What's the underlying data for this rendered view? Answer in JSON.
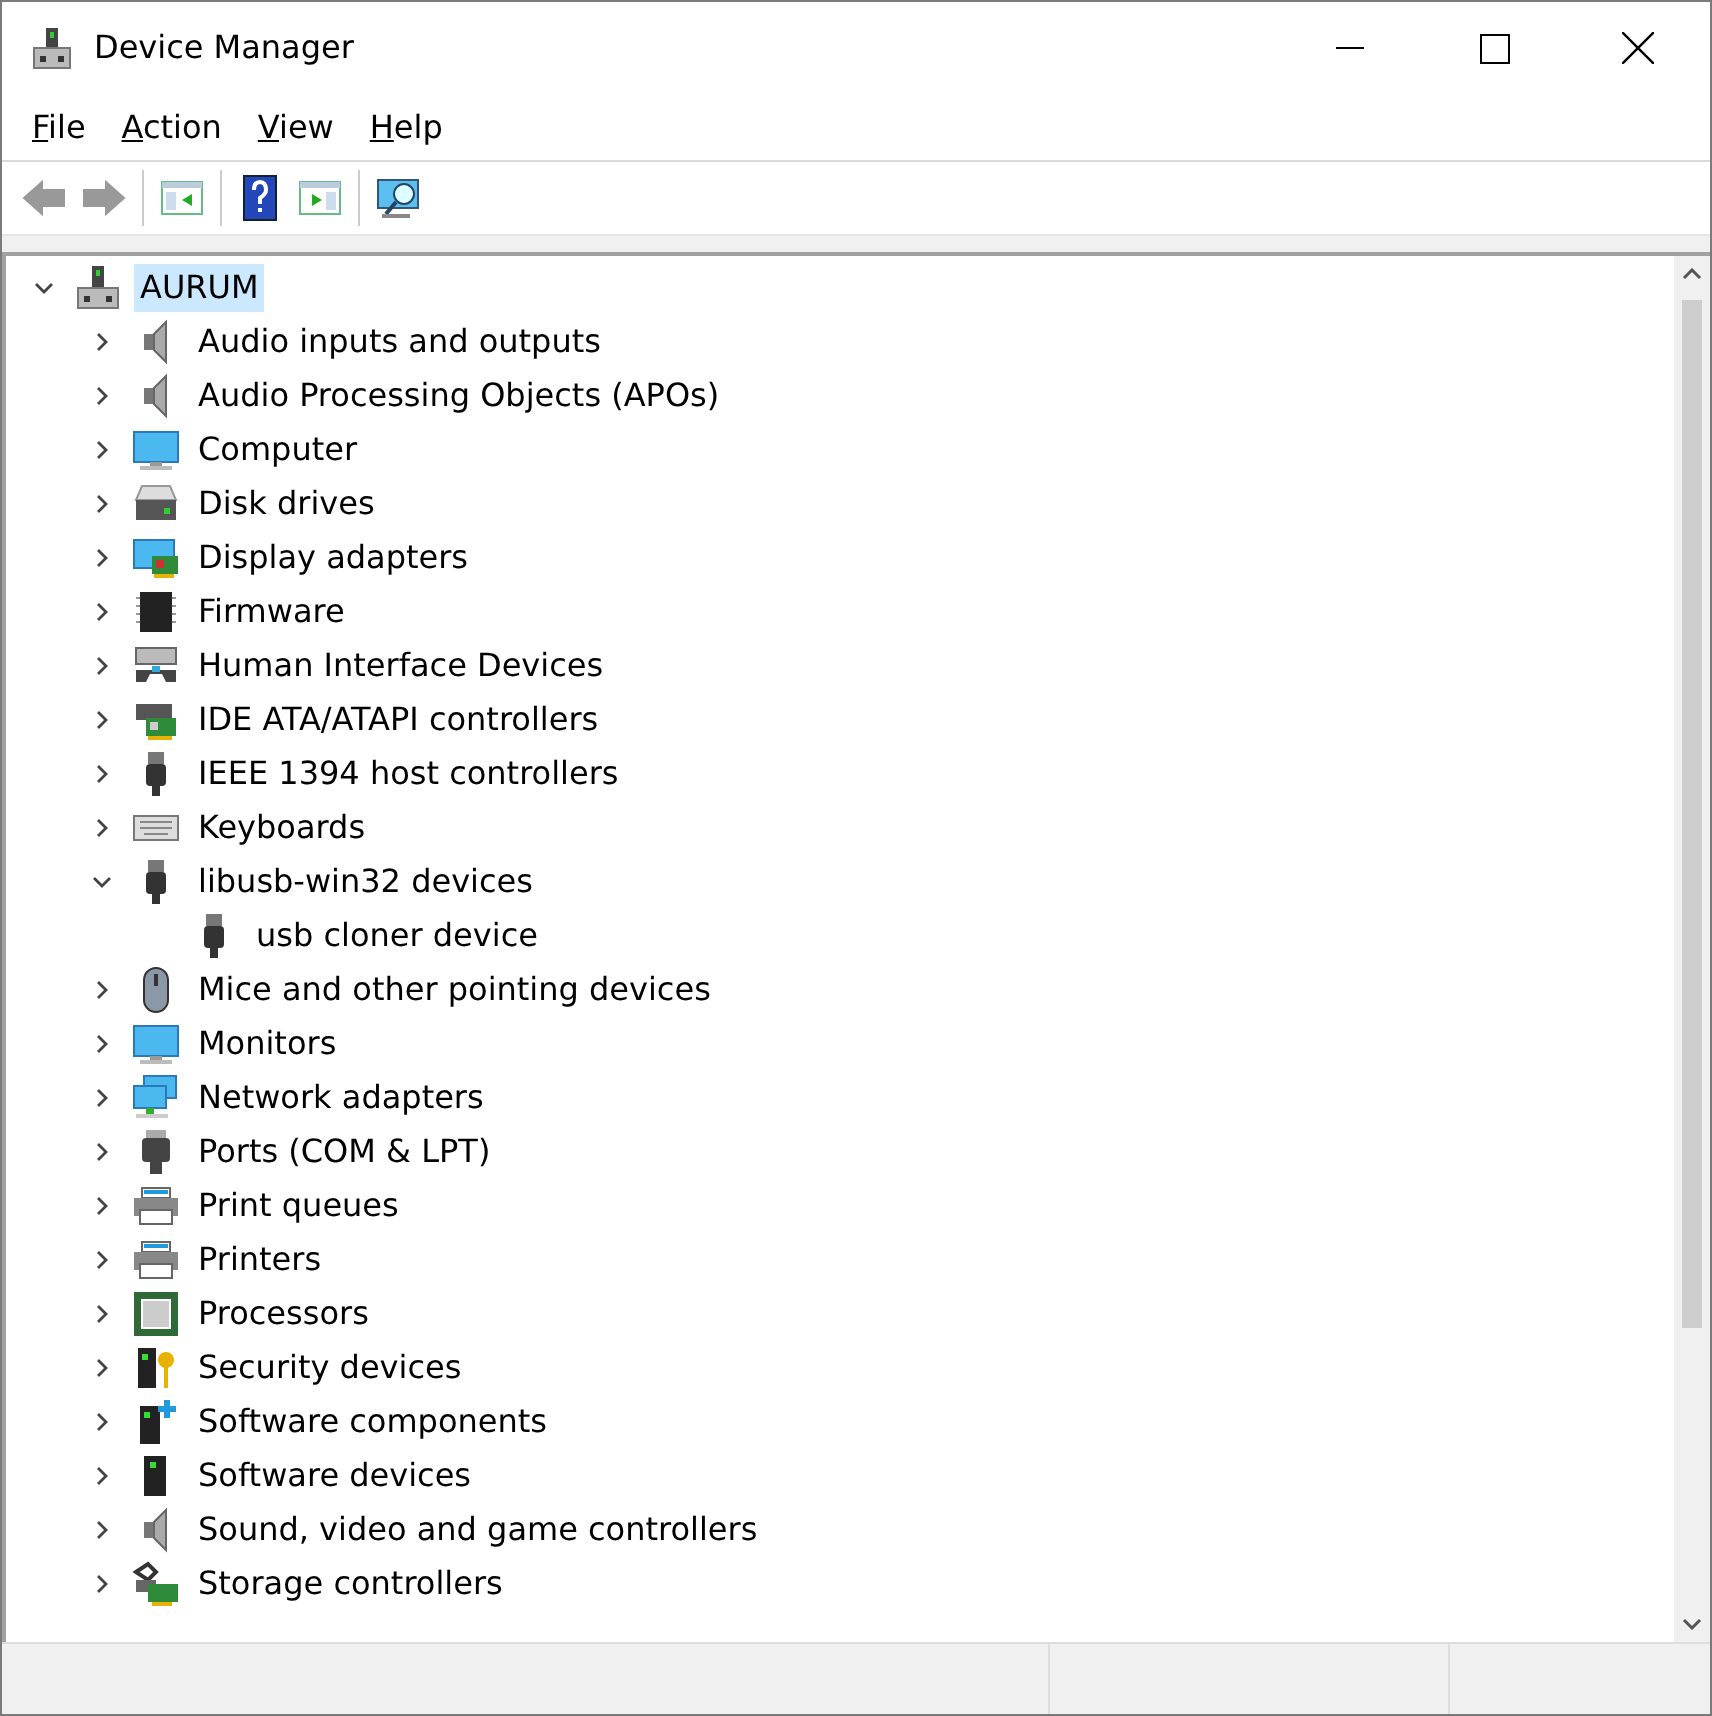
{
  "window": {
    "title": "Device Manager"
  },
  "menu": [
    "File",
    "Action",
    "View",
    "Help"
  ],
  "toolbar": [
    {
      "kind": "back",
      "disabled": true
    },
    {
      "kind": "forward",
      "disabled": true
    },
    {
      "kind": "sep"
    },
    {
      "kind": "console"
    },
    {
      "kind": "sep"
    },
    {
      "kind": "help"
    },
    {
      "kind": "action-pane"
    },
    {
      "kind": "sep"
    },
    {
      "kind": "scan"
    }
  ],
  "tree": {
    "label": "AURUM",
    "kind": "computer-root",
    "expanded": true,
    "selected": true,
    "children": [
      {
        "label": "Audio inputs and outputs",
        "kind": "speaker",
        "expanded": false
      },
      {
        "label": "Audio Processing Objects (APOs)",
        "kind": "speaker",
        "expanded": false
      },
      {
        "label": "Computer",
        "kind": "monitor",
        "expanded": false
      },
      {
        "label": "Disk drives",
        "kind": "disk",
        "expanded": false
      },
      {
        "label": "Display adapters",
        "kind": "display-card",
        "expanded": false
      },
      {
        "label": "Firmware",
        "kind": "chip",
        "expanded": false
      },
      {
        "label": "Human Interface Devices",
        "kind": "hid",
        "expanded": false
      },
      {
        "label": "IDE ATA/ATAPI controllers",
        "kind": "ide",
        "expanded": false
      },
      {
        "label": "IEEE 1394 host controllers",
        "kind": "plug",
        "expanded": false
      },
      {
        "label": "Keyboards",
        "kind": "keyboard",
        "expanded": false
      },
      {
        "label": "libusb-win32 devices",
        "kind": "plug",
        "expanded": true,
        "children": [
          {
            "label": "usb cloner device",
            "kind": "plug"
          }
        ]
      },
      {
        "label": "Mice and other pointing devices",
        "kind": "mouse",
        "expanded": false
      },
      {
        "label": "Monitors",
        "kind": "monitor",
        "expanded": false
      },
      {
        "label": "Network adapters",
        "kind": "network",
        "expanded": false
      },
      {
        "label": "Ports (COM & LPT)",
        "kind": "port",
        "expanded": false
      },
      {
        "label": "Print queues",
        "kind": "printer",
        "expanded": false
      },
      {
        "label": "Printers",
        "kind": "printer",
        "expanded": false
      },
      {
        "label": "Processors",
        "kind": "cpu",
        "expanded": false
      },
      {
        "label": "Security devices",
        "kind": "security",
        "expanded": false
      },
      {
        "label": "Software components",
        "kind": "sw-component",
        "expanded": false
      },
      {
        "label": "Software devices",
        "kind": "sw-device",
        "expanded": false
      },
      {
        "label": "Sound, video and game controllers",
        "kind": "speaker",
        "expanded": false
      },
      {
        "label": "Storage controllers",
        "kind": "storage",
        "expanded": false
      }
    ]
  }
}
